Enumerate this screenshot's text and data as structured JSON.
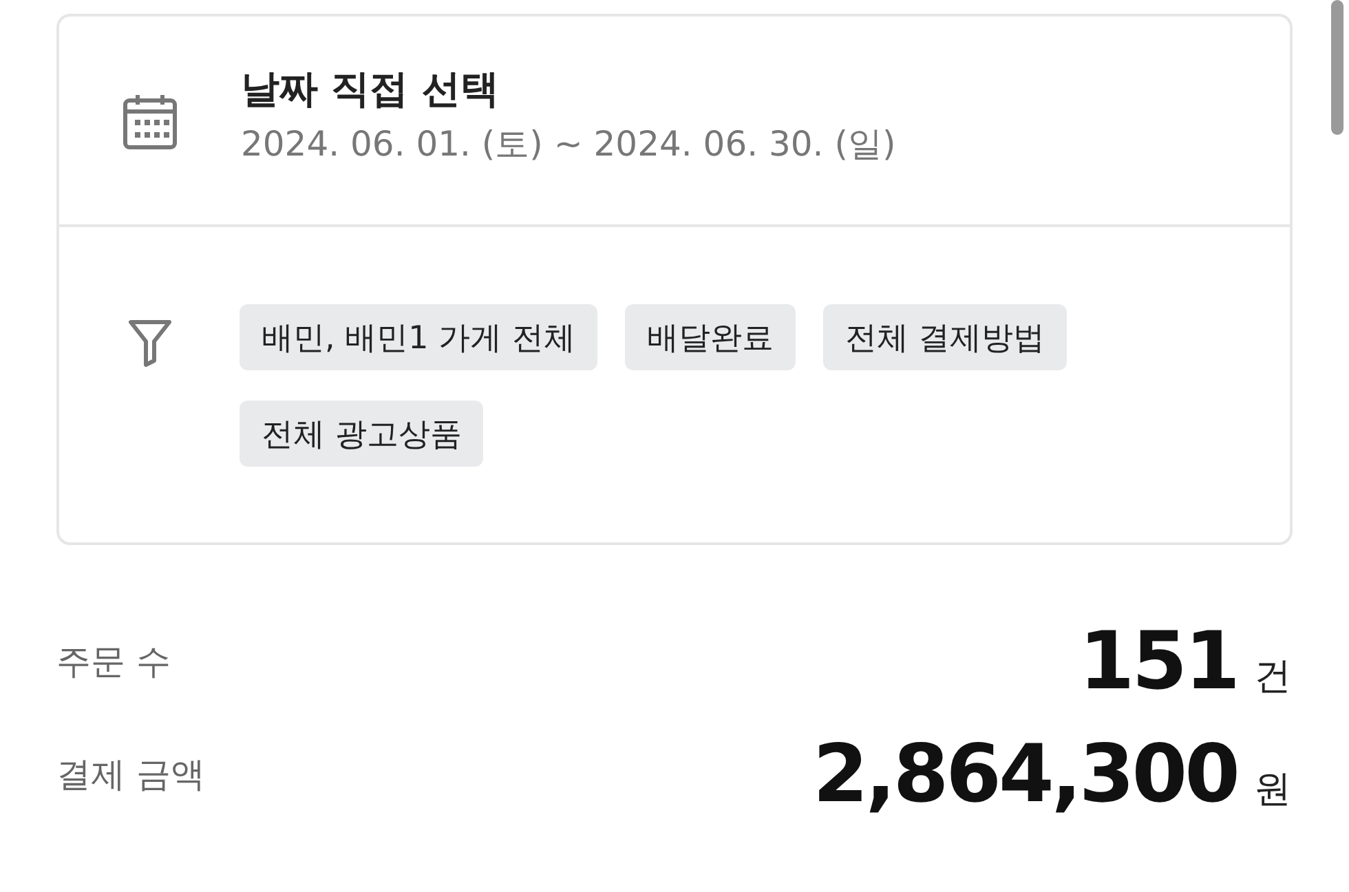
{
  "date_filter": {
    "title": "날짜 직접 선택",
    "range": "2024. 06. 01. (토) ~ 2024. 06. 30. (일)"
  },
  "filter_chips": [
    "배민, 배민1 가게 전체",
    "배달완료",
    "전체 결제방법",
    "전체 광고상품"
  ],
  "stats": [
    {
      "label": "주문 수",
      "value": "151",
      "unit": "건"
    },
    {
      "label": "결제 금액",
      "value": "2,864,300",
      "unit": "원"
    }
  ]
}
